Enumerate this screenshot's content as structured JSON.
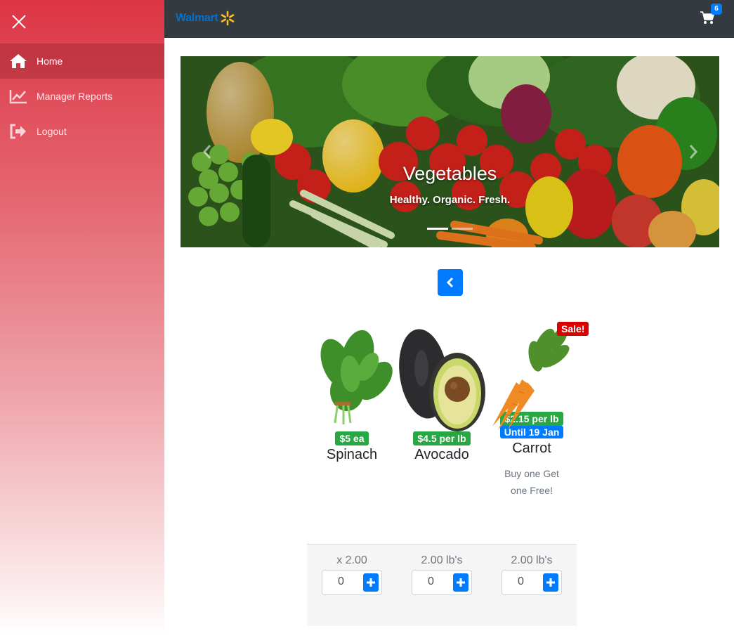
{
  "sidebar": {
    "items": [
      {
        "label": "Home",
        "icon": "home-icon",
        "active": true
      },
      {
        "label": "Manager Reports",
        "icon": "chart-icon",
        "active": false
      },
      {
        "label": "Logout",
        "icon": "logout-icon",
        "active": false
      }
    ]
  },
  "topbar": {
    "brand": "Walmart",
    "cart_count": "6"
  },
  "carousel": {
    "title": "Vegetables",
    "caption": "Healthy. Organic. Fresh.",
    "slide_count": 2,
    "active_slide": 1
  },
  "products": [
    {
      "name": "Spinach",
      "price": "$5 ea",
      "unit": "x 2.00",
      "qty": "0"
    },
    {
      "name": "Avocado",
      "price": "$4.5 per lb",
      "unit": "2.00 lb's",
      "qty": "0"
    },
    {
      "name": "Carrot",
      "price": "$2.15 per lb",
      "sale_badge": "Sale!",
      "until": "Until 19 Jan",
      "description": "Buy one Get one Free!",
      "unit": "2.00 lb's",
      "qty": "0"
    }
  ],
  "colors": {
    "sidebar_top": "#dc3545",
    "topbar": "#343a40",
    "primary": "#007bff",
    "price_badge": "#28a745",
    "sale_badge": "#dc0000",
    "brand": "#0071ce",
    "spark": "#ffc220"
  }
}
